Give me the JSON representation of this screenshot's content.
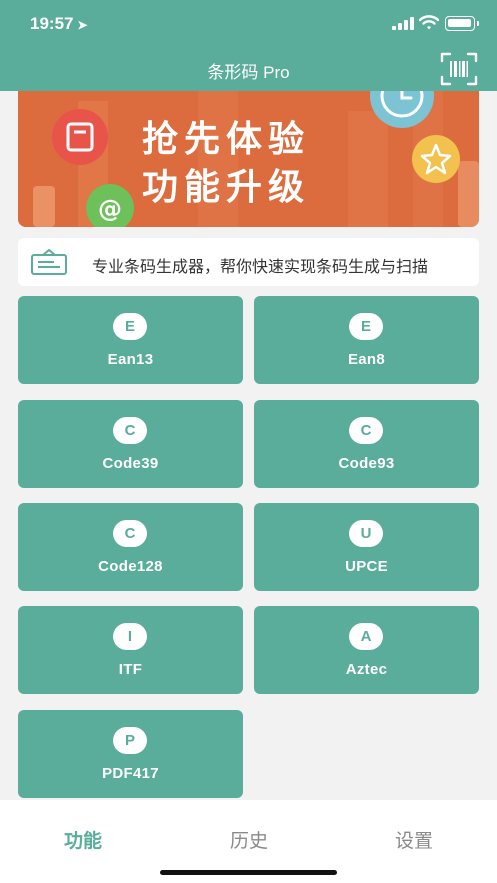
{
  "status_bar": {
    "time": "19:57",
    "location_icon": "location-arrow-icon",
    "signal_icon": "signal-icon",
    "wifi_icon": "wifi-icon",
    "battery_icon": "battery-icon"
  },
  "nav": {
    "title": "条形码 Pro",
    "scan_icon": "barcode-scan-icon"
  },
  "banner": {
    "line1": "抢先体验",
    "line2": "功能升级"
  },
  "notice": {
    "icon": "notice-board-icon",
    "text": "专业条码生成器，帮你快速实现条码生成与扫描"
  },
  "barcode_types": [
    {
      "badge": "E",
      "label": "Ean13"
    },
    {
      "badge": "E",
      "label": "Ean8"
    },
    {
      "badge": "C",
      "label": "Code39"
    },
    {
      "badge": "C",
      "label": "Code93"
    },
    {
      "badge": "C",
      "label": "Code128"
    },
    {
      "badge": "U",
      "label": "UPCE"
    },
    {
      "badge": "I",
      "label": "ITF"
    },
    {
      "badge": "A",
      "label": "Aztec"
    },
    {
      "badge": "P",
      "label": "PDF417"
    }
  ],
  "tabs": [
    {
      "label": "功能",
      "active": true
    },
    {
      "label": "历史",
      "active": false
    },
    {
      "label": "设置",
      "active": false
    }
  ],
  "colors": {
    "primary": "#5aad9b",
    "background": "#f2f2f2",
    "banner": "#d96a3d"
  }
}
